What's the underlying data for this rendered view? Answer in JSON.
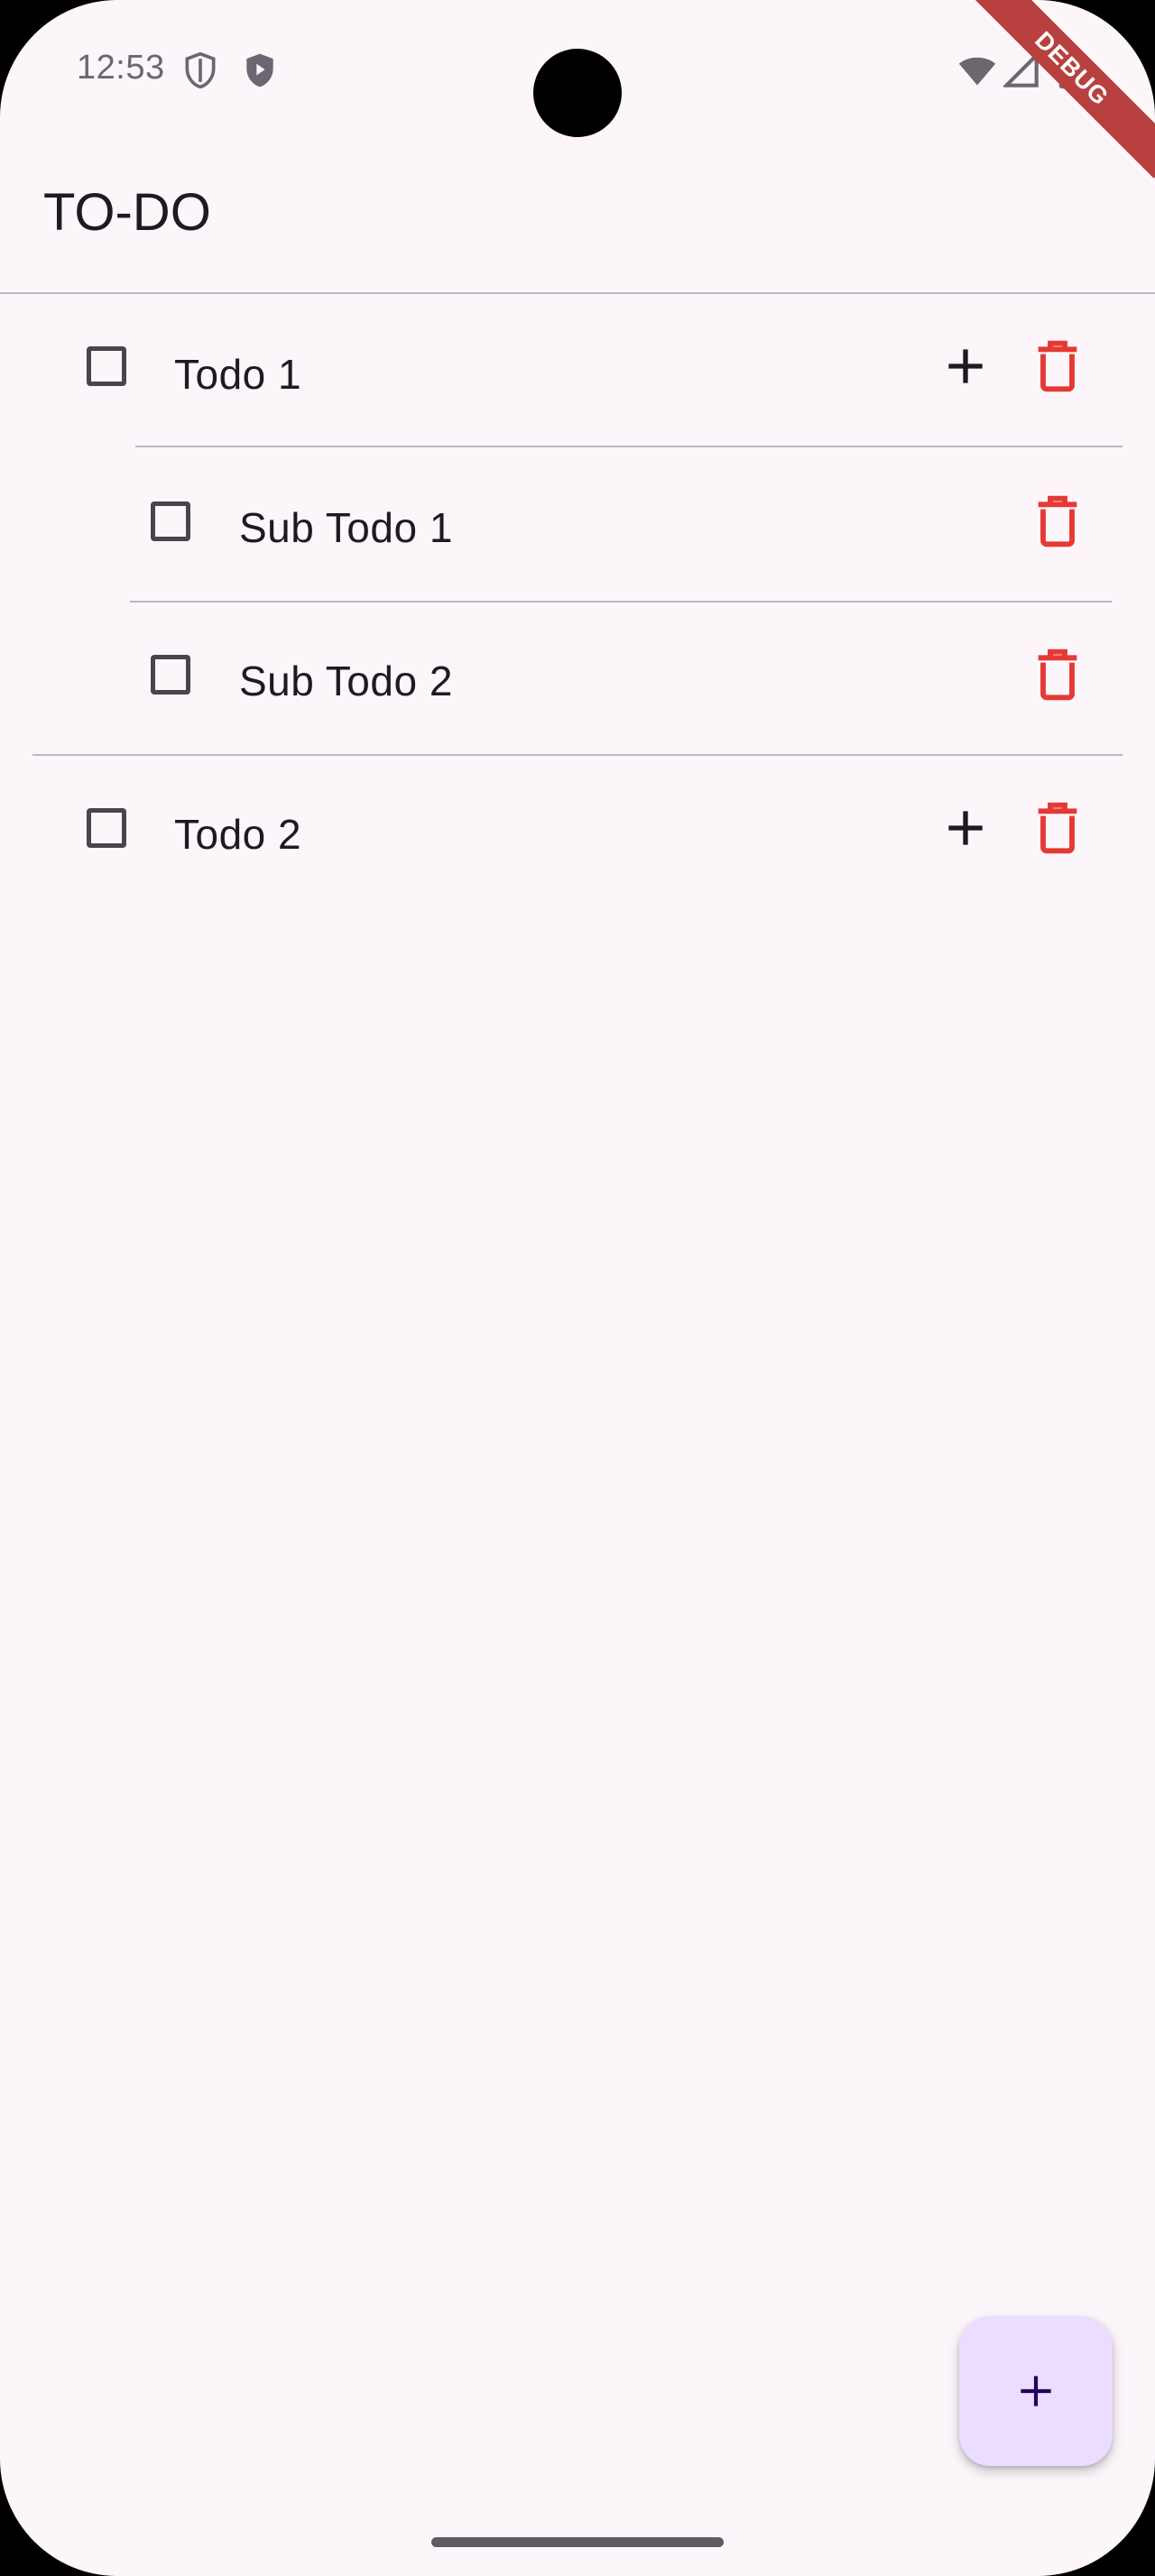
{
  "status_bar": {
    "time": "12:53",
    "icons": [
      "shield-icon",
      "play-shield-icon",
      "wifi-icon",
      "signal-icon",
      "battery-icon"
    ]
  },
  "debug_banner": "DEBUG",
  "app_bar": {
    "title": "TO-DO"
  },
  "todos": [
    {
      "label": "Todo 1",
      "checked": false,
      "subtodos": [
        {
          "label": "Sub Todo 1",
          "checked": false
        },
        {
          "label": "Sub Todo 2",
          "checked": false
        }
      ]
    },
    {
      "label": "Todo 2",
      "checked": false,
      "subtodos": []
    }
  ],
  "colors": {
    "background": "#fcf6fb",
    "delete": "#e53935",
    "fab": "#eaddff",
    "text": "#1d1b20"
  },
  "icons": {
    "add": "plus-icon",
    "delete": "trash-icon",
    "fab": "plus-icon"
  }
}
